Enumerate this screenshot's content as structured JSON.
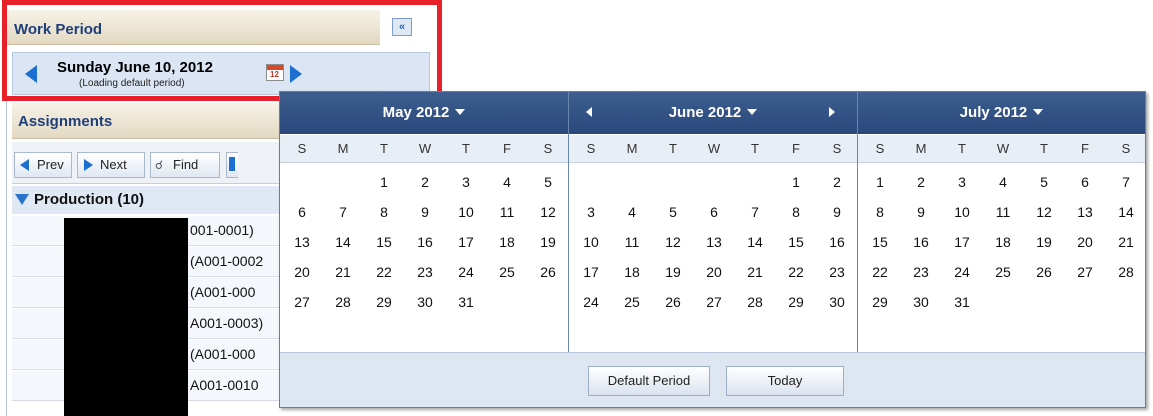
{
  "work_period": {
    "title": "Work Period",
    "collapse_label": "«",
    "date_label": "Sunday June 10, 2012",
    "date_sub": "(Loading default period)",
    "calendar_icon_number": "12"
  },
  "assignments": {
    "title": "Assignments",
    "toolbar": {
      "prev_label": "Prev",
      "next_label": "Next",
      "find_label": "Find"
    },
    "group_label": "Production (10)",
    "rows": [
      "001-0001)",
      "(A001-0002",
      "(A001-000",
      "A001-0003)",
      "(A001-000",
      "A001-0010"
    ]
  },
  "calendar": {
    "weekday_letters": [
      "S",
      "M",
      "T",
      "W",
      "T",
      "F",
      "S"
    ],
    "months": [
      {
        "title": "May 2012",
        "first_weekday": 2,
        "days": 31
      },
      {
        "title": "June 2012",
        "first_weekday": 5,
        "days": 30
      },
      {
        "title": "July 2012",
        "first_weekday": 0,
        "days": 31
      }
    ],
    "footer": {
      "default_label": "Default Period",
      "today_label": "Today"
    }
  },
  "colors": {
    "highlight": "#e8202a",
    "header_blue": "#29477a",
    "accent_blue": "#1b6fd1"
  },
  "icons": [
    "prev-day-arrow-icon",
    "next-day-arrow-icon",
    "calendar-icon",
    "collapse-icon",
    "find-icon"
  ]
}
